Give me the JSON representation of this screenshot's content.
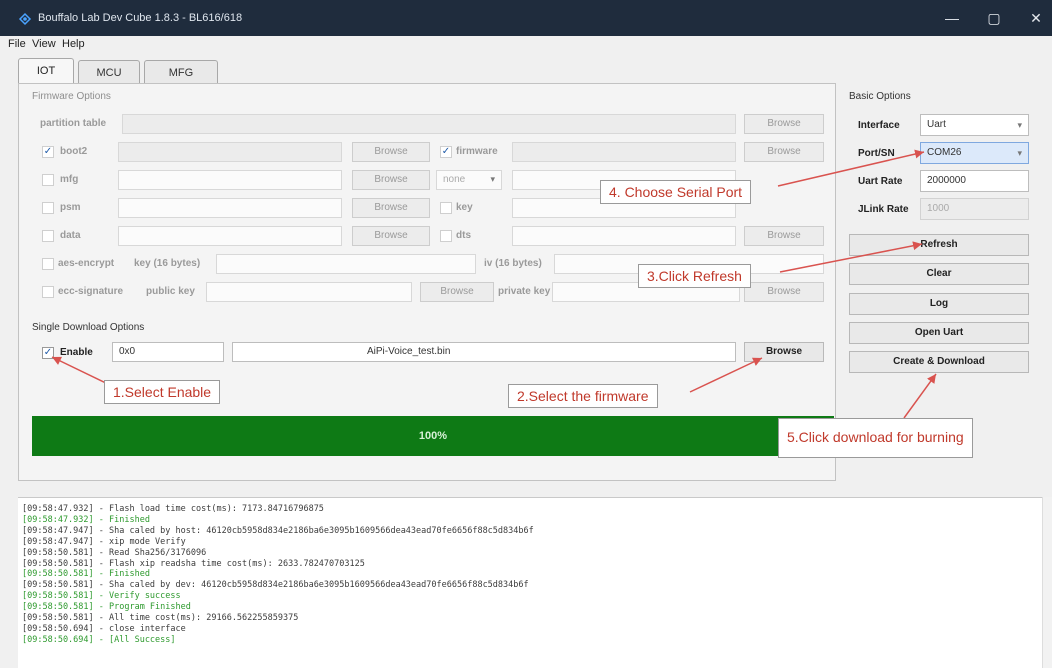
{
  "window": {
    "title": "Bouffalo Lab Dev Cube 1.8.3 - BL616/618",
    "minimize": "—",
    "maximize": "▢",
    "close": "✕"
  },
  "menu": [
    "File",
    "View",
    "Help"
  ],
  "tabs": [
    "IOT",
    "MCU",
    "MFG"
  ],
  "firmware_options": {
    "group_label": "Firmware Options",
    "partition_table": "partition table",
    "boot2": "boot2",
    "firmware": "firmware",
    "mfg": "mfg",
    "none": "none",
    "psm": "psm",
    "key": "key",
    "data": "data",
    "dts": "dts",
    "aes_encrypt": "aes-encrypt",
    "aes_key": "key (16 bytes)",
    "iv": "iv (16 bytes)",
    "ecc_signature": "ecc-signature",
    "public_key": "public key",
    "private_key": "private key",
    "browse": "Browse"
  },
  "single_download": {
    "group_label": "Single Download Options",
    "enable_label": "Enable",
    "address": "0x0",
    "file": "AiPi-Voice_test.bin",
    "browse": "Browse"
  },
  "basic_options": {
    "title": "Basic Options",
    "interface_label": "Interface",
    "interface_value": "Uart",
    "port_label": "Port/SN",
    "port_value": "COM26",
    "uart_rate_label": "Uart Rate",
    "uart_rate_value": "2000000",
    "jlink_rate_label": "JLink Rate",
    "jlink_rate_value": "1000"
  },
  "buttons": {
    "refresh": "Refresh",
    "clear": "Clear",
    "log": "Log",
    "open_uart": "Open Uart",
    "create_download": "Create & Download"
  },
  "progress": {
    "label": "100%",
    "value": 1.0
  },
  "log_lines": [
    {
      "text": "[09:58:47.932] - Flash load time cost(ms): 7173.84716796875",
      "green": false
    },
    {
      "text": "[09:58:47.932] - Finished",
      "green": true
    },
    {
      "text": "[09:58:47.947] - Sha caled by host: 46120cb5958d834e2186ba6e3095b1609566dea43ead70fe6656f88c5d834b6f",
      "green": false
    },
    {
      "text": "[09:58:47.947] - xip mode Verify",
      "green": false
    },
    {
      "text": "[09:58:50.581] - Read Sha256/3176096",
      "green": false
    },
    {
      "text": "[09:58:50.581] - Flash xip readsha time cost(ms): 2633.782470703125",
      "green": false
    },
    {
      "text": "[09:58:50.581] - Finished",
      "green": true
    },
    {
      "text": "[09:58:50.581] - Sha caled by dev: 46120cb5958d834e2186ba6e3095b1609566dea43ead70fe6656f88c5d834b6f",
      "green": false
    },
    {
      "text": "[09:58:50.581] - Verify success",
      "green": true
    },
    {
      "text": "[09:58:50.581] - Program Finished",
      "green": true
    },
    {
      "text": "[09:58:50.581] - All time cost(ms): 29166.562255859375",
      "green": false
    },
    {
      "text": "[09:58:50.694] - close interface",
      "green": false
    },
    {
      "text": "[09:58:50.694] - [All Success]",
      "green": true
    }
  ],
  "callouts": {
    "step1": "1.Select Enable",
    "step2": "2.Select the firmware",
    "step3": "3.Click Refresh",
    "step4": "4. Choose Serial Port",
    "step5": "5.Click download for burning"
  },
  "colors": {
    "progress": "#0e7a15",
    "callout_text": "#c0392b",
    "arrow": "#d9534f"
  }
}
